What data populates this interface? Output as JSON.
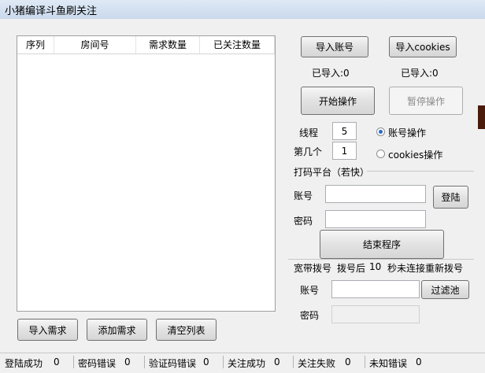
{
  "window": {
    "title": "小猪编译斗鱼刷关注"
  },
  "list": {
    "columns": [
      "序列",
      "房间号",
      "需求数量",
      "已关注数量"
    ]
  },
  "bottom_buttons": {
    "import": "导入需求",
    "add": "添加需求",
    "clear": "清空列表"
  },
  "right": {
    "import_account": "导入账号",
    "import_cookies": "导入cookies",
    "imported_accounts": "已导入:0",
    "imported_cookies": "已导入:0",
    "start": "开始操作",
    "pause": "暂停操作",
    "threads_label": "线程",
    "threads_value": "5",
    "nth_label": "第几个",
    "nth_value": "1",
    "radio_account": "账号操作",
    "radio_cookies": "cookies操作",
    "captcha_group": "打码平台（若快）",
    "account_label": "账号",
    "login": "登陆",
    "password_label": "密码",
    "end": "结束程序",
    "broadband": "宽带拨号",
    "dial_after": "拨号后",
    "dial_seconds": "10",
    "dial_suffix": "秒未连接重新拨号",
    "acct2_label": "账号",
    "filter": "过滤池",
    "pwd2_label": "密码"
  },
  "statusbar": [
    {
      "label": "登陆成功",
      "value": "0"
    },
    {
      "label": "密码错误",
      "value": "0"
    },
    {
      "label": "验证码错误",
      "value": "0"
    },
    {
      "label": "关注成功",
      "value": "0"
    },
    {
      "label": "关注失败",
      "value": "0"
    },
    {
      "label": "未知错误",
      "value": "0"
    }
  ]
}
